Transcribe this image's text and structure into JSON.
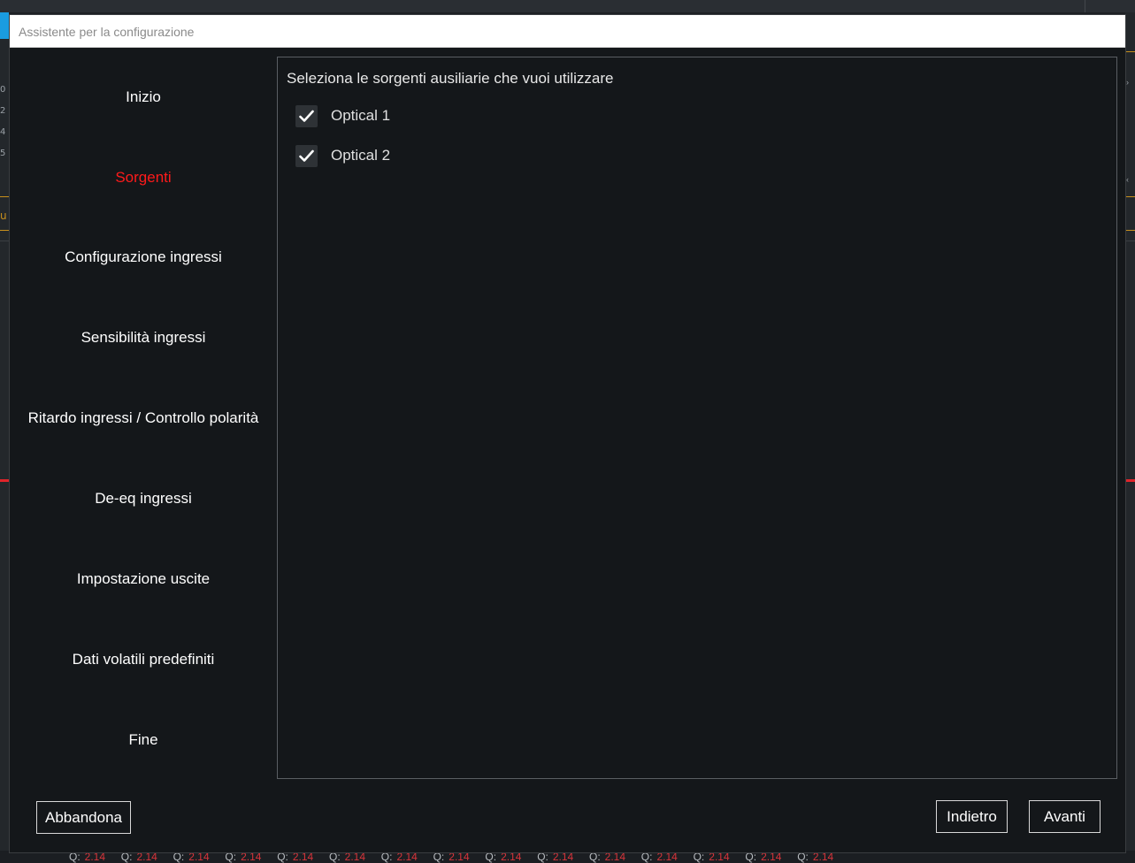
{
  "dialog": {
    "title": "Assistente per la configurazione"
  },
  "sidebar": {
    "items": [
      {
        "label": "Inizio",
        "active": false
      },
      {
        "label": "Sorgenti",
        "active": true
      },
      {
        "label": "Configurazione ingressi",
        "active": false
      },
      {
        "label": "Sensibilità ingressi",
        "active": false
      },
      {
        "label": "Ritardo ingressi / Controllo polarità",
        "active": false
      },
      {
        "label": "De-eq ingressi",
        "active": false
      },
      {
        "label": "Impostazione uscite",
        "active": false
      },
      {
        "label": "Dati volatili predefiniti",
        "active": false
      },
      {
        "label": "Fine",
        "active": false
      }
    ]
  },
  "content": {
    "heading": "Seleziona le sorgenti ausiliarie che vuoi utilizzare",
    "options": [
      {
        "label": "Optical 1",
        "checked": true
      },
      {
        "label": "Optical 2",
        "checked": true
      }
    ]
  },
  "footer": {
    "abandon_label": "Abbandona",
    "back_label": "Indietro",
    "next_label": "Avanti"
  },
  "background": {
    "left_numbers": [
      "0",
      "2",
      "4",
      "5"
    ],
    "left_partial_text": "u",
    "bottom_q_label": "Q:",
    "bottom_q_value": "2.14",
    "bottom_q_count": 15
  },
  "colors": {
    "active_item": "#ff1a1a",
    "accent_orange": "#c8901c",
    "accent_red": "#e0242a",
    "bg_blue": "#1a9ce0"
  }
}
